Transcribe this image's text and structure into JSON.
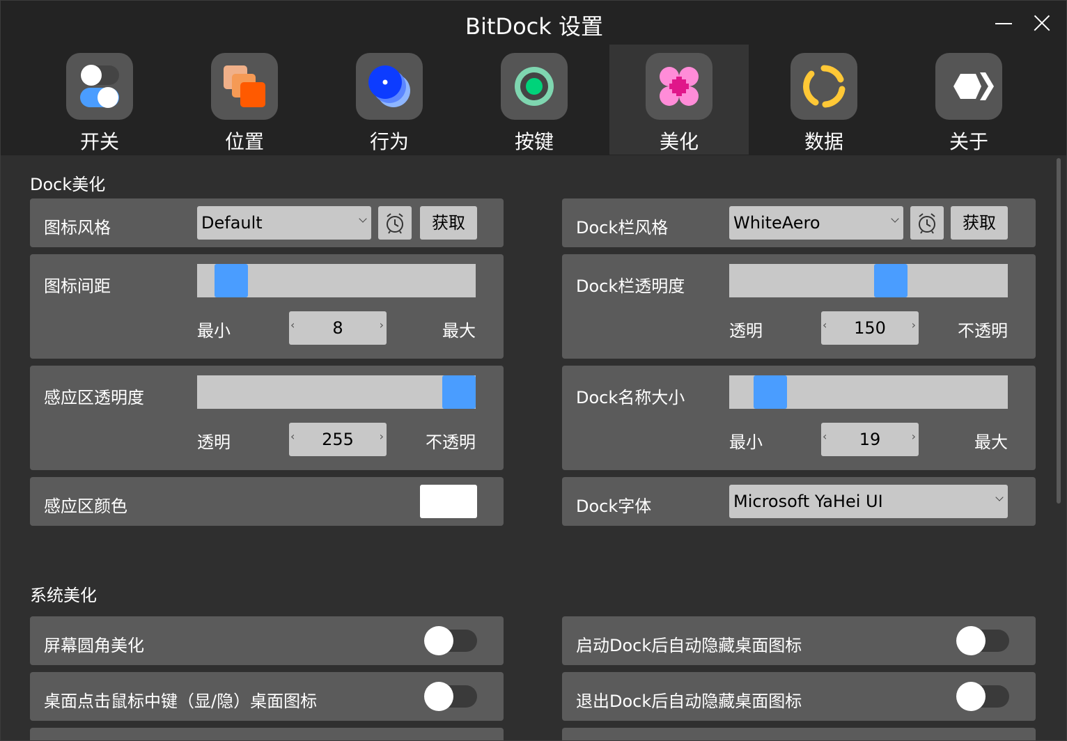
{
  "window": {
    "title": "BitDock 设置"
  },
  "tabs": [
    {
      "label": "开关",
      "icon": "toggles-icon"
    },
    {
      "label": "位置",
      "icon": "stacked-squares-icon"
    },
    {
      "label": "行为",
      "icon": "blue-dot-icon"
    },
    {
      "label": "按键",
      "icon": "green-ring-icon"
    },
    {
      "label": "美化",
      "icon": "flower-icon",
      "active": true
    },
    {
      "label": "数据",
      "icon": "dashed-circle-icon"
    },
    {
      "label": "关于",
      "icon": "hexagon-chevron-icon"
    }
  ],
  "dock": {
    "section_title": "Dock美化",
    "icon_style": {
      "label": "图标风格",
      "value": "Default",
      "fetch": "获取"
    },
    "bar_style": {
      "label": "Dock栏风格",
      "value": "WhiteAero",
      "fetch": "获取"
    },
    "icon_spacing": {
      "label": "图标间距",
      "min_label": "最小",
      "max_label": "最大",
      "value": "8",
      "level": 0.07
    },
    "bar_opacity": {
      "label": "Dock栏透明度",
      "min_label": "透明",
      "max_label": "不透明",
      "value": "150",
      "level": 0.59
    },
    "zone_opacity": {
      "label": "感应区透明度",
      "min_label": "透明",
      "max_label": "不透明",
      "value": "255",
      "level": 1.0
    },
    "name_size": {
      "label": "Dock名称大小",
      "min_label": "最小",
      "max_label": "最大",
      "value": "19",
      "level": 0.1
    },
    "zone_color": {
      "label": "感应区颜色",
      "color": "#ffffff"
    },
    "font": {
      "label": "Dock字体",
      "value": "Microsoft YaHei UI"
    }
  },
  "system": {
    "section_title": "系统美化",
    "toggles": [
      {
        "label": "屏幕圆角美化",
        "on": false
      },
      {
        "label": "启动Dock后自动隐藏桌面图标",
        "on": false
      },
      {
        "label": "桌面点击鼠标中键（显/隐）桌面图标",
        "on": false
      },
      {
        "label": "退出Dock后自动隐藏桌面图标",
        "on": false
      }
    ]
  },
  "colors": {
    "accent": "#4a9dff",
    "card": "#5b5b5b",
    "control": "#c8c8c8",
    "background": "#2f2f2f",
    "titlebar": "#232323"
  }
}
